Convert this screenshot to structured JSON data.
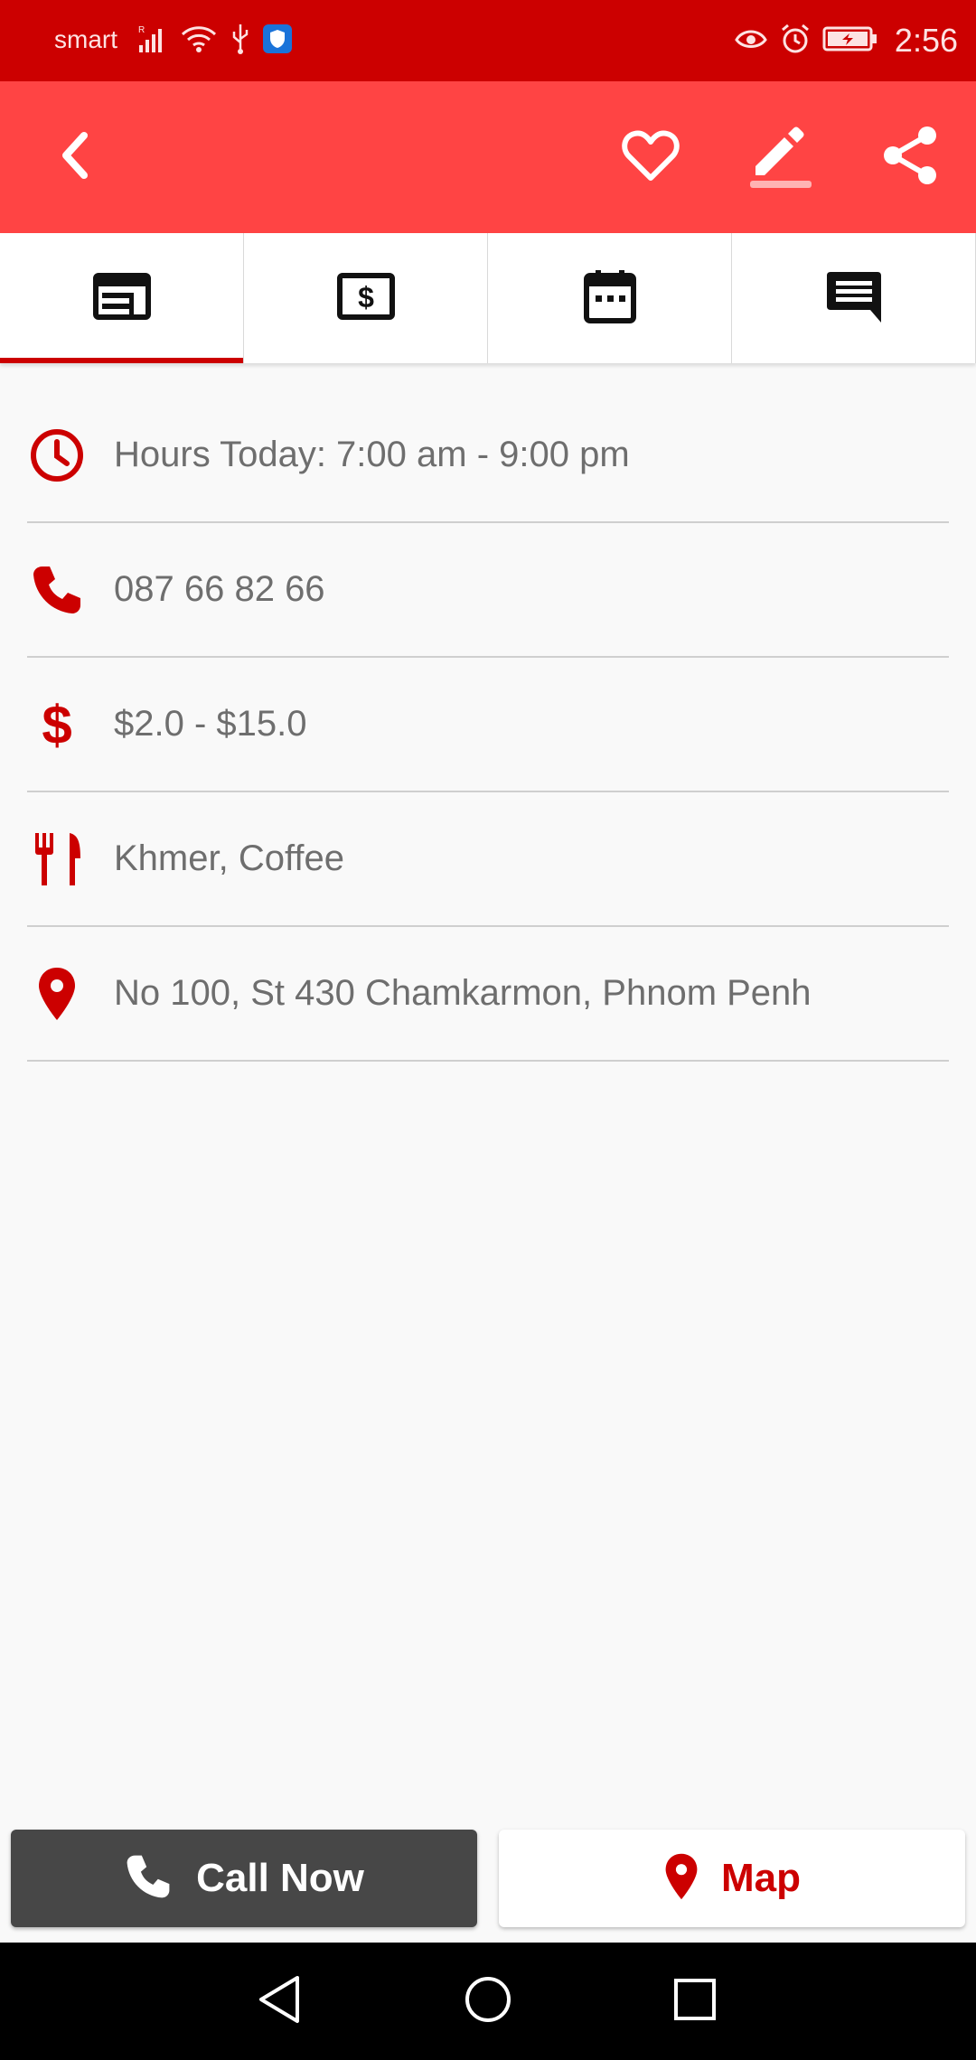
{
  "status_bar": {
    "carrier": "smart",
    "time": "2:56",
    "icons": [
      "signal-icon",
      "wifi-icon",
      "usb-icon",
      "shield-app-icon",
      "eye-icon",
      "alarm-icon",
      "battery-icon"
    ]
  },
  "app_bar": {
    "back_icon": "chevron-left-icon",
    "actions": [
      "heart-icon",
      "edit-icon",
      "share-icon"
    ]
  },
  "tabs": [
    {
      "icon": "overview-icon",
      "active": true
    },
    {
      "icon": "price-icon",
      "active": false
    },
    {
      "icon": "calendar-icon",
      "active": false
    },
    {
      "icon": "comment-icon",
      "active": false
    }
  ],
  "info": {
    "hours": "Hours Today: 7:00 am - 9:00 pm",
    "phone": "087 66 82 66",
    "price": "$2.0 - $15.0",
    "cuisine": "Khmer, Coffee",
    "address": "No 100, St 430 Chamkarmon, Phnom Penh"
  },
  "actions": {
    "call_label": "Call Now",
    "map_label": "Map"
  },
  "colors": {
    "status_bar": "#cc0000",
    "app_bar": "#ff4444",
    "accent": "#cc0000",
    "call_button": "#474747"
  }
}
